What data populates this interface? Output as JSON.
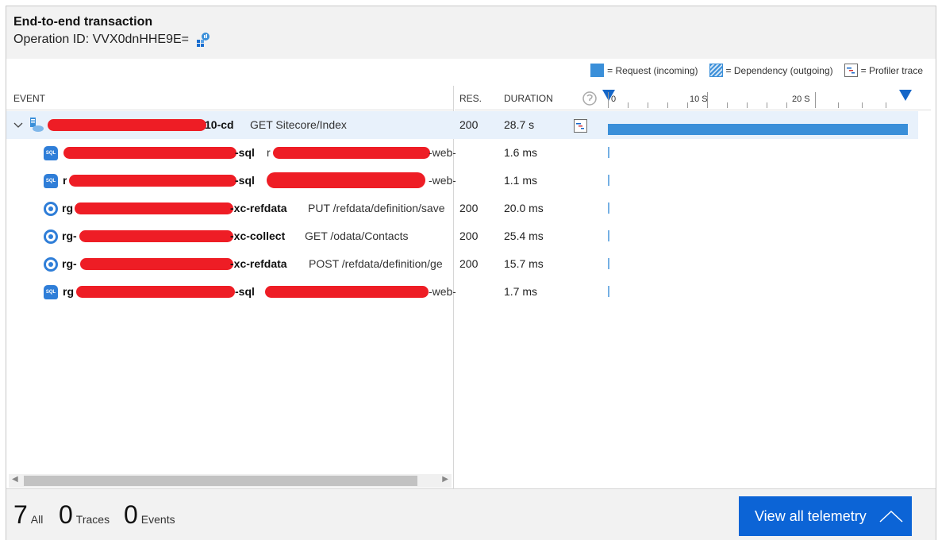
{
  "header": {
    "title": "End-to-end transaction",
    "operation_id": "Operation ID: VVX0dnHHE9E="
  },
  "legend": {
    "request": "= Request (incoming)",
    "dependency": "= Dependency (outgoing)",
    "profiler": "= Profiler trace"
  },
  "columns": {
    "event": "EVENT",
    "res": "RES.",
    "duration": "DURATION"
  },
  "timeline": {
    "ticks": [
      "0",
      "10 S",
      "20 S"
    ]
  },
  "rows": [
    {
      "name_prefix": "",
      "name_suffix": "10-cd",
      "operation": "GET Sitecore/Index",
      "res": "200",
      "duration": "28.7 s",
      "icon": "cloud-service-icon"
    },
    {
      "name_prefix": "",
      "name_suffix": "-sql",
      "operation_prefix": "r",
      "operation_suffix": "-web-",
      "res": "",
      "duration": "1.6 ms",
      "icon": "sql-database-icon"
    },
    {
      "name_prefix": "r",
      "name_suffix": "-sql",
      "operation_prefix": "",
      "operation_suffix": "-web-",
      "res": "",
      "duration": "1.1 ms",
      "icon": "sql-database-icon"
    },
    {
      "name_prefix": "rg",
      "name_suffix": "-xc-refdata",
      "operation": "PUT /refdata/definition/save",
      "res": "200",
      "duration": "20.0 ms",
      "icon": "app-service-icon"
    },
    {
      "name_prefix": "rg-",
      "name_suffix": "-xc-collect",
      "operation": "GET /odata/Contacts",
      "res": "200",
      "duration": "25.4 ms",
      "icon": "app-service-icon"
    },
    {
      "name_prefix": "rg-",
      "name_suffix": "-xc-refdata",
      "operation": "POST /refdata/definition/ge",
      "res": "200",
      "duration": "15.7 ms",
      "icon": "app-service-icon"
    },
    {
      "name_prefix": "rg",
      "name_suffix": "-sql",
      "operation_prefix": "",
      "operation_suffix": "-web-",
      "res": "",
      "duration": "1.7 ms",
      "icon": "sql-database-icon"
    }
  ],
  "footer": {
    "all_count": "7",
    "all_label": "All",
    "traces_count": "0",
    "traces_label": "Traces",
    "events_count": "0",
    "events_label": "Events",
    "button_label": "View all telemetry"
  },
  "colors": {
    "accent": "#0c64d6",
    "bar": "#3a8fd9",
    "redaction": "#ee1d25"
  }
}
